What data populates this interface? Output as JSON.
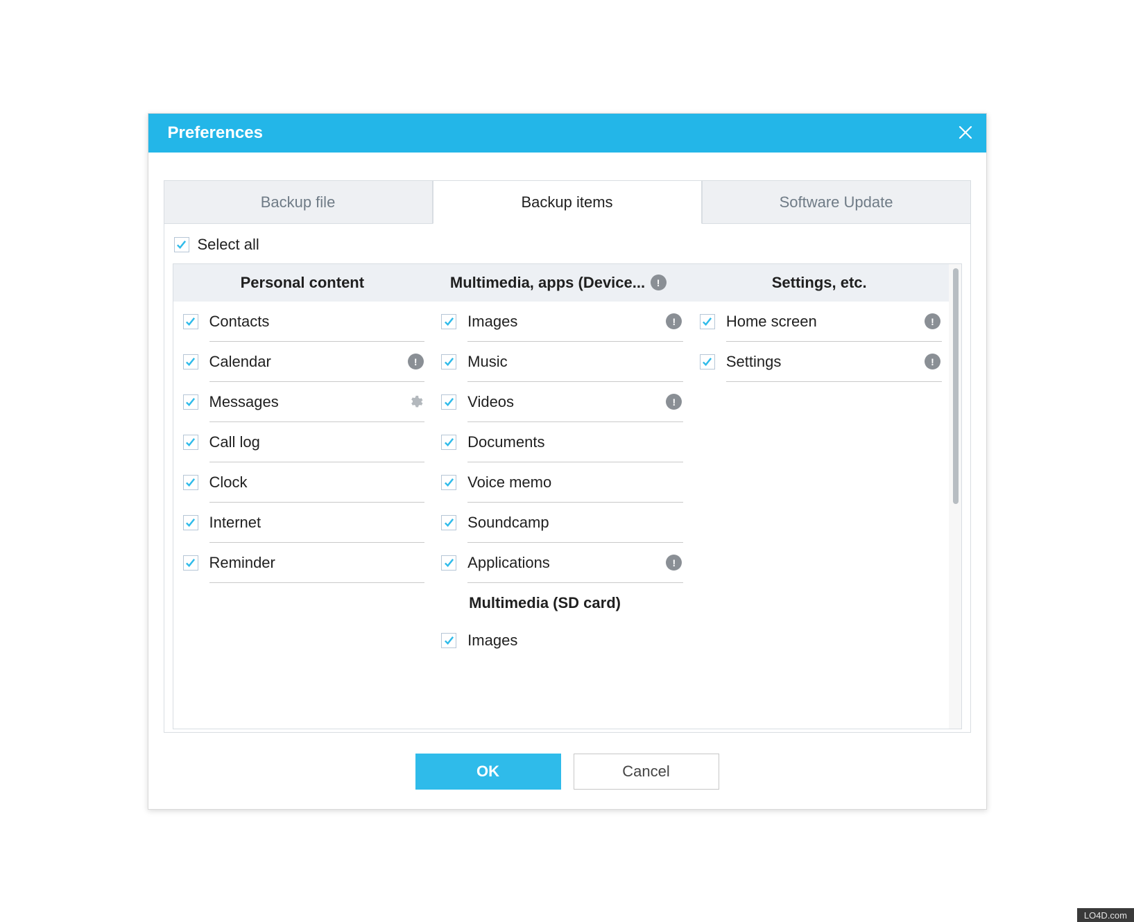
{
  "dialog": {
    "title": "Preferences"
  },
  "tabs": [
    {
      "label": "Backup file"
    },
    {
      "label": "Backup items"
    },
    {
      "label": "Software Update"
    }
  ],
  "select_all_label": "Select all",
  "columns": {
    "personal": {
      "header": "Personal content",
      "items": [
        {
          "label": "Contacts",
          "checked": true
        },
        {
          "label": "Calendar",
          "checked": true,
          "info": true
        },
        {
          "label": "Messages",
          "checked": true,
          "gear": true
        },
        {
          "label": "Call log",
          "checked": true
        },
        {
          "label": "Clock",
          "checked": true
        },
        {
          "label": "Internet",
          "checked": true
        },
        {
          "label": "Reminder",
          "checked": true
        }
      ]
    },
    "multimedia": {
      "header": "Multimedia, apps (Device...",
      "header_info": true,
      "sd_sub": "Multimedia (SD card)",
      "items": [
        {
          "label": "Images",
          "checked": true,
          "info": true
        },
        {
          "label": "Music",
          "checked": true
        },
        {
          "label": "Videos",
          "checked": true,
          "info": true
        },
        {
          "label": "Documents",
          "checked": true
        },
        {
          "label": "Voice memo",
          "checked": true
        },
        {
          "label": "Soundcamp",
          "checked": true
        },
        {
          "label": "Applications",
          "checked": true,
          "info": true
        }
      ],
      "sd_items": [
        {
          "label": "Images",
          "checked": true
        }
      ]
    },
    "settings": {
      "header": "Settings, etc.",
      "items": [
        {
          "label": "Home screen",
          "checked": true,
          "info": true
        },
        {
          "label": "Settings",
          "checked": true,
          "info": true
        }
      ]
    }
  },
  "buttons": {
    "ok": "OK",
    "cancel": "Cancel"
  },
  "watermark": "LO4D.com"
}
